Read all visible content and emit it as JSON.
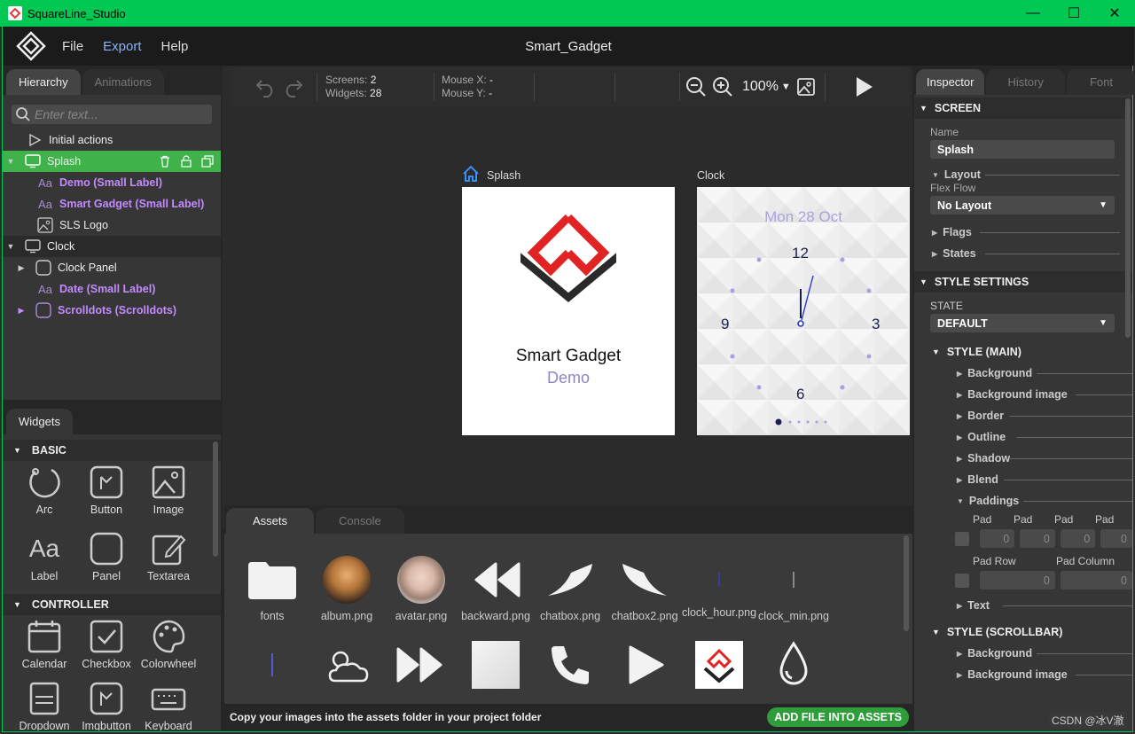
{
  "window": {
    "title": "SquareLine_Studio",
    "minimize": "—",
    "maximize": "☐",
    "close": "✕"
  },
  "menu": {
    "file": "File",
    "export": "Export",
    "help": "Help",
    "project_title": "Smart_Gadget"
  },
  "left_tabs": {
    "hierarchy": "Hierarchy",
    "animations": "Animations"
  },
  "search": {
    "placeholder": "Enter text..."
  },
  "hierarchy": [
    {
      "label": "Initial actions"
    },
    {
      "label": "Splash"
    },
    {
      "label": "Demo (Small Label)"
    },
    {
      "label": "Smart Gadget (Small Label)"
    },
    {
      "label": "SLS Logo"
    },
    {
      "label": "Clock"
    },
    {
      "label": "Clock Panel"
    },
    {
      "label": "Date (Small Label)"
    },
    {
      "label": "Scrolldots (Scrolldots)"
    }
  ],
  "widgets": {
    "tab": "Widgets",
    "basic_title": "BASIC",
    "basic": [
      "Arc",
      "Button",
      "Image",
      "Label",
      "Panel",
      "Textarea"
    ],
    "controller_title": "CONTROLLER",
    "controller": [
      "Calendar",
      "Checkbox",
      "Colorwheel",
      "Dropdown",
      "Imgbutton",
      "Keyboard"
    ]
  },
  "toolbar": {
    "screens_label": "Screens:",
    "screens_value": "2",
    "widgets_label": "Widgets:",
    "widgets_value": "28",
    "mousex_label": "Mouse X:",
    "mousex_value": "-",
    "mousey_label": "Mouse Y:",
    "mousey_value": "-",
    "zoom": "100%"
  },
  "canvas": {
    "splash_label": "Splash",
    "clock_label": "Clock",
    "splash_title": "Smart Gadget",
    "splash_sub": "Demo",
    "clock_date": "Mon 28 Oct",
    "n12": "12",
    "n3": "3",
    "n6": "6",
    "n9": "9"
  },
  "bottom_tabs": {
    "assets": "Assets",
    "console": "Console"
  },
  "assets": [
    "fonts",
    "album.png",
    "avatar.png",
    "backward.png",
    "chatbox.png",
    "chatbox2.png",
    "clock_hour.png",
    "clock_min.png"
  ],
  "assets_footer": {
    "hint": "Copy your images into the assets folder in your project folder",
    "button": "ADD FILE INTO ASSETS"
  },
  "inspector": {
    "tabs": {
      "inspector": "Inspector",
      "history": "History",
      "font": "Font"
    },
    "screen_title": "SCREEN",
    "name_label": "Name",
    "name_value": "Splash",
    "layout": "Layout",
    "flex_flow": "Flex Flow",
    "flex_value": "No Layout",
    "flags": "Flags",
    "states": "States",
    "style_settings": "STYLE SETTINGS",
    "state_label": "STATE",
    "state_value": "DEFAULT",
    "style_main": "STYLE (MAIN)",
    "props": [
      "Background",
      "Background image",
      "Border",
      "Outline",
      "Shadow",
      "Blend",
      "Paddings"
    ],
    "pad_labels": [
      "Pad",
      "Pad",
      "Pad",
      "Pad"
    ],
    "pad_values": [
      "0",
      "0",
      "0",
      "0"
    ],
    "pad_row": "Pad Row",
    "pad_column": "Pad Column",
    "pad_row_value": "0",
    "pad_column_value": "0",
    "text": "Text",
    "style_scrollbar": "STYLE (SCROLLBAR)",
    "scroll_props": [
      "Background",
      "Background image"
    ]
  },
  "watermark": "CSDN @冰V澈",
  "colors": {
    "accent": "#00c853",
    "selection": "#3fb24a",
    "purple": "#c38bff",
    "button": "#2e9d3a"
  }
}
